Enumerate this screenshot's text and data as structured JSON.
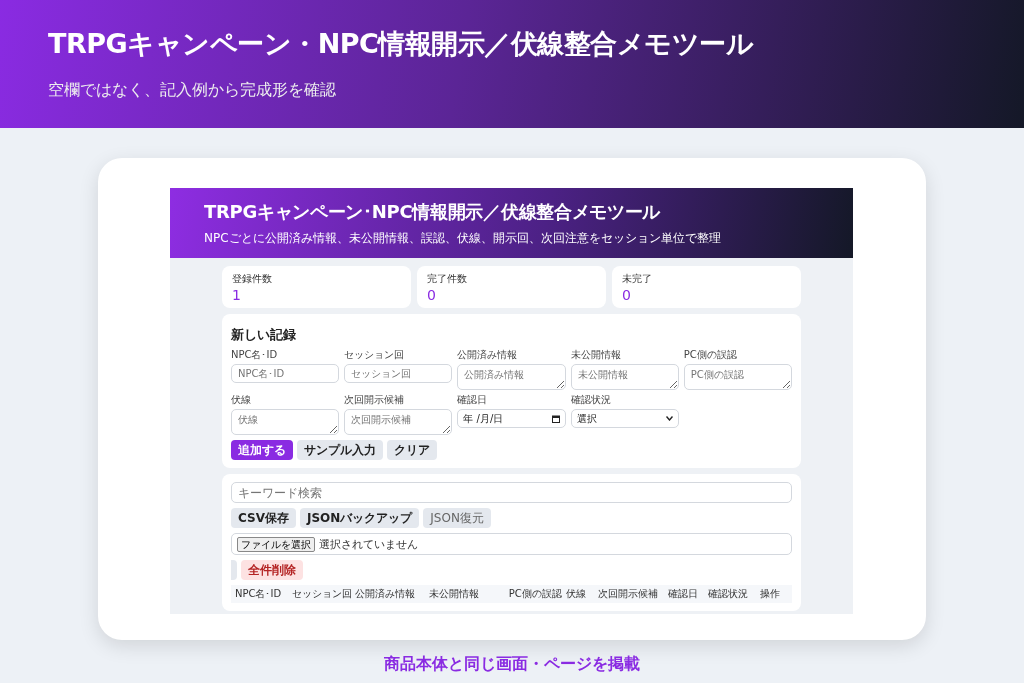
{
  "banner": {
    "title": "TRPGキャンペーン・NPC情報開示／伏線整合メモツール",
    "subtitle": "空欄ではなく、記入例から完成形を確認"
  },
  "screen": {
    "title": "TRPGキャンペーン･NPC情報開示／伏線整合メモツール",
    "subtitle": "NPCごとに公開済み情報、未公開情報、誤認、伏線、開示回、次回注意をセッション単位で整理",
    "stats": [
      {
        "label": "登録件数",
        "value": "1"
      },
      {
        "label": "完了件数",
        "value": "0"
      },
      {
        "label": "未完了",
        "value": "0"
      }
    ],
    "form": {
      "title": "新しい記録",
      "fields": [
        {
          "kind": "text",
          "label": "NPC名･ID",
          "placeholder": "NPC名･ID"
        },
        {
          "kind": "text",
          "label": "セッション回",
          "placeholder": "セッション回"
        },
        {
          "kind": "textarea",
          "label": "公開済み情報",
          "placeholder": "公開済み情報"
        },
        {
          "kind": "textarea",
          "label": "未公開情報",
          "placeholder": "未公開情報"
        },
        {
          "kind": "textarea",
          "label": "PC側の誤認",
          "placeholder": "PC側の誤認"
        },
        {
          "kind": "textarea",
          "label": "伏線",
          "placeholder": "伏線"
        },
        {
          "kind": "textarea",
          "label": "次回開示候補",
          "placeholder": "次回開示候補"
        },
        {
          "kind": "date",
          "label": "確認日",
          "value": "年 /月/日"
        },
        {
          "kind": "select",
          "label": "確認状況",
          "value": "選択"
        }
      ],
      "buttons": [
        {
          "kind": "primary",
          "label": "追加する"
        },
        {
          "kind": "secondary",
          "label": "サンプル入力"
        },
        {
          "kind": "secondary",
          "label": "クリア"
        }
      ]
    },
    "list": {
      "search_placeholder": "キーワード検索",
      "buttons": [
        {
          "kind": "secondary",
          "label": "CSV保存"
        },
        {
          "kind": "secondary",
          "label": "JSONバックアップ"
        },
        {
          "kind": "plain",
          "label": "JSON復元"
        }
      ],
      "file": {
        "button": "ファイルを選択",
        "status": "選択されていません"
      },
      "delete_button": "全件削除",
      "columns": [
        "NPC名･ID",
        "セッション回",
        "公開済み情報",
        "未公開情報",
        "PC側の誤認",
        "伏線",
        "次回開示候補",
        "確認日",
        "確認状況",
        "操作"
      ]
    }
  },
  "caption": "商品本体と同じ画面・ページを掲載"
}
